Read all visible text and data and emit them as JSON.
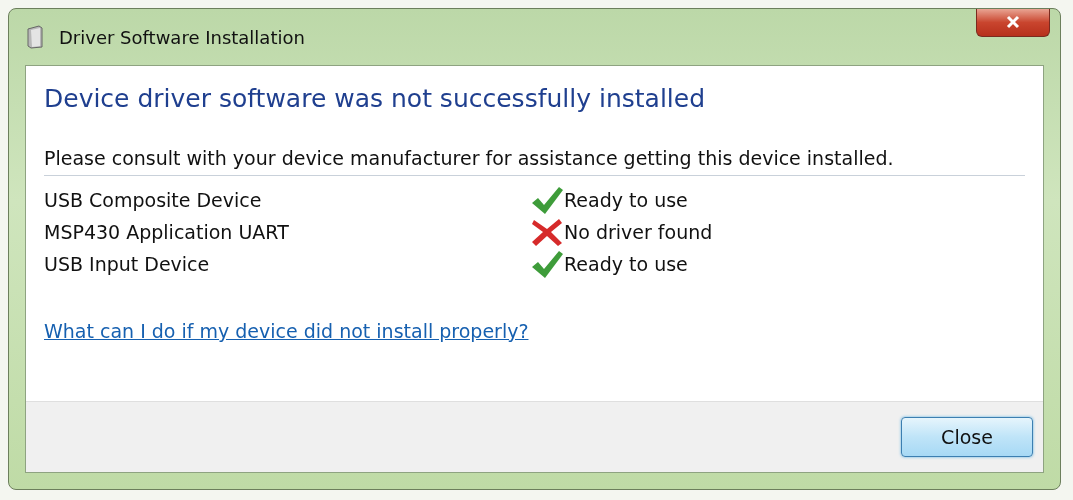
{
  "window": {
    "title": "Driver Software Installation"
  },
  "heading": "Device driver software was not successfully installed",
  "message": "Please consult with your device manufacturer for assistance getting this device installed.",
  "devices": [
    {
      "name": "USB Composite Device",
      "status": "Ready to use",
      "kind": "ready"
    },
    {
      "name": "MSP430 Application UART",
      "status": "No driver found",
      "kind": "failed"
    },
    {
      "name": "USB Input Device",
      "status": "Ready to use",
      "kind": "ready"
    }
  ],
  "help_link": "What can I do if my device did not install properly?",
  "buttons": [
    "Close"
  ]
}
